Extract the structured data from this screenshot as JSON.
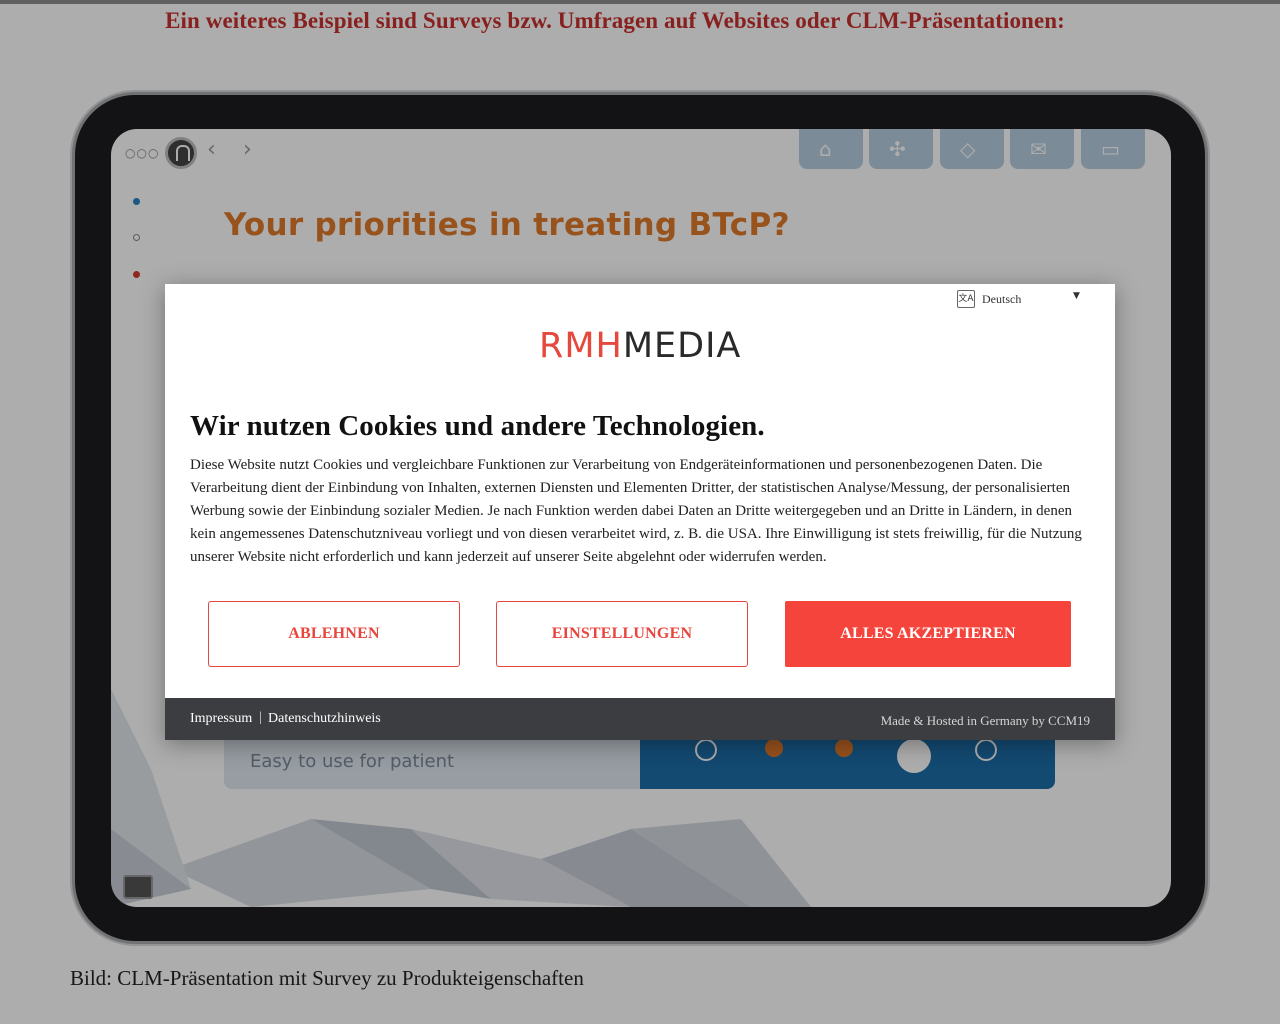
{
  "page": {
    "heading": "Ein weiteres Beispiel sind Surveys bzw. Umfragen auf Websites oder CLM-Präsentationen:",
    "caption": "Bild: CLM-Präsentation mit Survey zu Produkteigenschaften"
  },
  "tablet": {
    "title": "Your priorities in treating BTcP?",
    "row_label": "Easy to use for patient",
    "nav_icons": [
      "home-icon",
      "network-icon",
      "diamond-icon",
      "mail-icon",
      "cards-icon"
    ]
  },
  "cookie_banner": {
    "language": "Deutsch",
    "logo_red": "RMH",
    "logo_dark": "MEDIA",
    "title": "Wir nutzen Cookies und andere Technologien.",
    "body": "Diese Website nutzt Cookies und vergleichbare Funktionen zur Verarbeitung von Endgeräteinformationen und personenbezogenen Daten. Die Verarbeitung dient der Einbindung von Inhalten, externen Diensten und Elementen Dritter, der statistischen Analyse/Messung, der personalisierten Werbung sowie der Einbindung sozialer Medien. Je nach Funktion werden dabei Daten an Dritte weitergegeben und an Dritte in Ländern, in denen kein angemessenes Datenschutzniveau vorliegt und von diesen verarbeitet wird, z. B. die USA. Ihre Einwilligung ist stets freiwillig, für die Nutzung unserer Website nicht erforderlich und kann jederzeit auf unserer Seite abgelehnt oder widerrufen werden.",
    "buttons": {
      "reject": "ABLEHNEN",
      "settings": "EINSTELLUNGEN",
      "accept": "ALLES AKZEPTIEREN"
    },
    "footer": {
      "imprint": "Impressum",
      "separator": "|",
      "privacy": "Datenschutzhinweis",
      "made_by": "Made & Hosted in Germany by CCM19"
    }
  },
  "colors": {
    "accent": "#f5443c",
    "heading": "#c8322f",
    "footer_bg": "#3c3d40"
  }
}
